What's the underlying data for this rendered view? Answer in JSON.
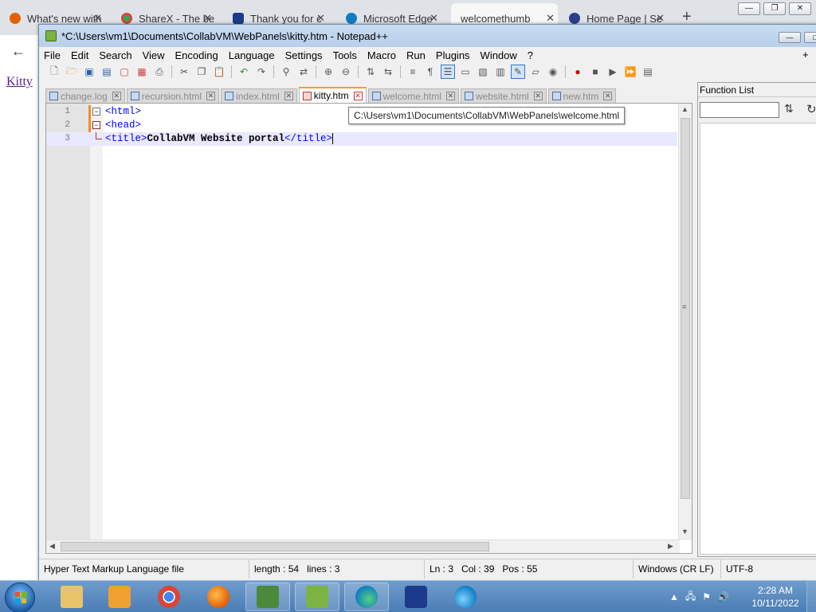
{
  "browser": {
    "tabs": [
      {
        "label": "What's new with"
      },
      {
        "label": "ShareX - The be"
      },
      {
        "label": "Thank you for c"
      },
      {
        "label": "Microsoft Edge"
      },
      {
        "label": "welcomethumb"
      },
      {
        "label": "Home Page | Se"
      }
    ],
    "new_tab": "+",
    "back_arrow": "←",
    "page_link": "Kitty"
  },
  "npp": {
    "title": "*C:\\Users\\vm1\\Documents\\CollabVM\\WebPanels\\kitty.htm - Notepad++",
    "menu": [
      "File",
      "Edit",
      "Search",
      "View",
      "Encoding",
      "Language",
      "Settings",
      "Tools",
      "Macro",
      "Run",
      "Plugins",
      "Window",
      "?"
    ],
    "menu_plus": "+",
    "doc_tabs": [
      {
        "label": "change.log"
      },
      {
        "label": "recursion.html"
      },
      {
        "label": "index.html"
      },
      {
        "label": "kitty.htm"
      },
      {
        "label": "welcome.html"
      },
      {
        "label": "website.html"
      },
      {
        "label": "new.htm"
      }
    ],
    "tooltip": "C:\\Users\\vm1\\Documents\\CollabVM\\WebPanels\\welcome.html",
    "code_lines": [
      {
        "num": "1",
        "open": "<html>"
      },
      {
        "num": "2",
        "open": "<head>"
      },
      {
        "num": "3",
        "open": "<title>",
        "text": "CollabVM Website portal",
        "close": "</title>"
      }
    ],
    "function_list_title": "Function List",
    "status": {
      "file_type": "Hyper Text Markup Language file",
      "length": "length : 54",
      "lines": "lines : 3",
      "ln": "Ln : 3",
      "col": "Col : 39",
      "pos": "Pos : 55",
      "eol": "Windows (CR LF)",
      "encoding": "UTF-8"
    }
  },
  "taskbar": {
    "time": "2:28 AM",
    "date": "10/11/2022"
  },
  "colors": {
    "firefox": "#e66000",
    "chrome": "#db4437",
    "edge": "#0f7dc2",
    "malwarebytes": "#1b3a8c"
  }
}
